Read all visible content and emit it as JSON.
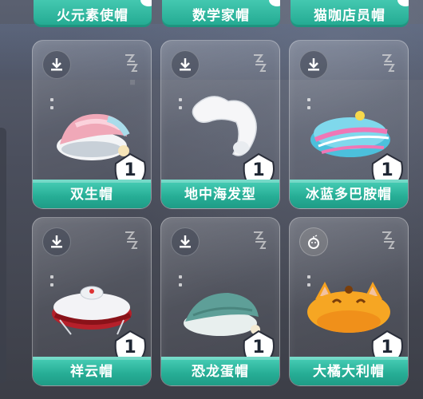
{
  "top_row": [
    {
      "label": "火元素使帽"
    },
    {
      "label": "数学家帽"
    },
    {
      "label": "猫咖店员帽"
    }
  ],
  "cards": [
    {
      "label": "双生帽",
      "count": "1",
      "icon": "download-icon",
      "item_icon": "pink-nightcap-icon"
    },
    {
      "label": "地中海发型",
      "count": "1",
      "icon": "download-icon",
      "item_icon": "white-hair-icon"
    },
    {
      "label": "冰蓝多巴胺帽",
      "count": "1",
      "icon": "download-icon",
      "item_icon": "blue-beret-icon"
    },
    {
      "label": "祥云帽",
      "count": "1",
      "icon": "download-icon",
      "item_icon": "cloud-hat-icon"
    },
    {
      "label": "恐龙蛋帽",
      "count": "1",
      "icon": "download-icon",
      "item_icon": "dino-egg-hat-icon"
    },
    {
      "label": "大橘大利帽",
      "count": "1",
      "icon": "bomb-icon",
      "item_icon": "orange-cat-hat-icon"
    }
  ],
  "colors": {
    "label_teal": "#26ad95",
    "badge_white": "#ffffff",
    "count_text": "#1e2633"
  }
}
